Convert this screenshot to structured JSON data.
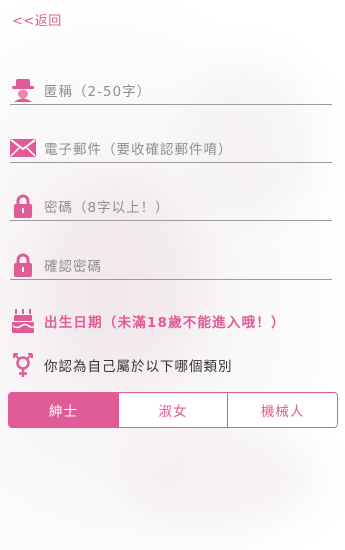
{
  "colors": {
    "accent": "#e05c96",
    "accent_text": "#ffffff",
    "field_line": "#9b9b9b"
  },
  "nav": {
    "back_label": "<<返回"
  },
  "form": {
    "nickname": {
      "placeholder": "匿稱（2-50字）",
      "icon": "person-icon"
    },
    "email": {
      "placeholder": "電子郵件（要收確認郵件唷）",
      "icon": "envelope-icon"
    },
    "password": {
      "placeholder": "密碼（8字以上！）",
      "icon": "lock-icon"
    },
    "confirm_password": {
      "placeholder": "確認密碼",
      "icon": "lock-icon"
    },
    "birthday": {
      "placeholder": "出生日期（未滿18歲不能進入哦！）",
      "icon": "cake-icon"
    }
  },
  "gender": {
    "question": "你認為自己屬於以下哪個類別",
    "icon": "gender-symbol-icon",
    "options": [
      {
        "label": "紳士",
        "selected": true
      },
      {
        "label": "淑女",
        "selected": false
      },
      {
        "label": "機械人",
        "selected": false
      }
    ]
  }
}
